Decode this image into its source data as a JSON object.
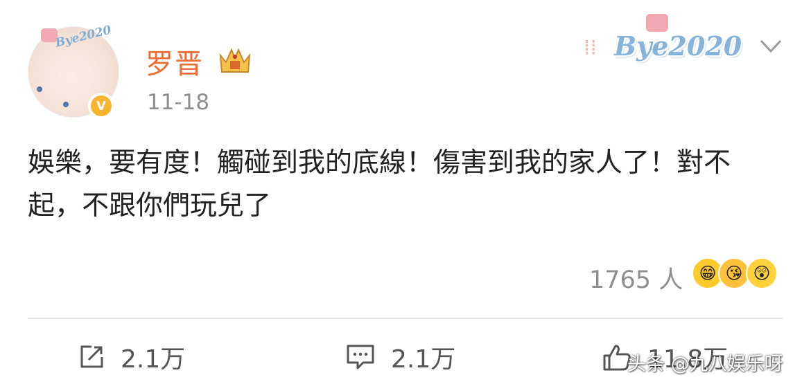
{
  "post": {
    "author": "罗晋",
    "timestamp": "11-18",
    "verified_badge": "V",
    "text": "娛樂，要有度！觸碰到我的底線！傷害到我的家人了！對不起，不跟你們玩兒了",
    "reactions_count": "1765 人",
    "reaction_emojis": [
      "grinning-face",
      "kissing-face",
      "shocked-face"
    ]
  },
  "decoration": {
    "card_label": "Bye2020",
    "avatar_label": "Bye2020"
  },
  "actions": {
    "repost_count": "2.1万",
    "comment_count": "2.1万",
    "like_count": "11.8万"
  },
  "watermark": "头条 @九八娱乐呀",
  "colors": {
    "username": "#f06a33",
    "badge": "#f7b42c",
    "muted": "#8e8e8e"
  }
}
